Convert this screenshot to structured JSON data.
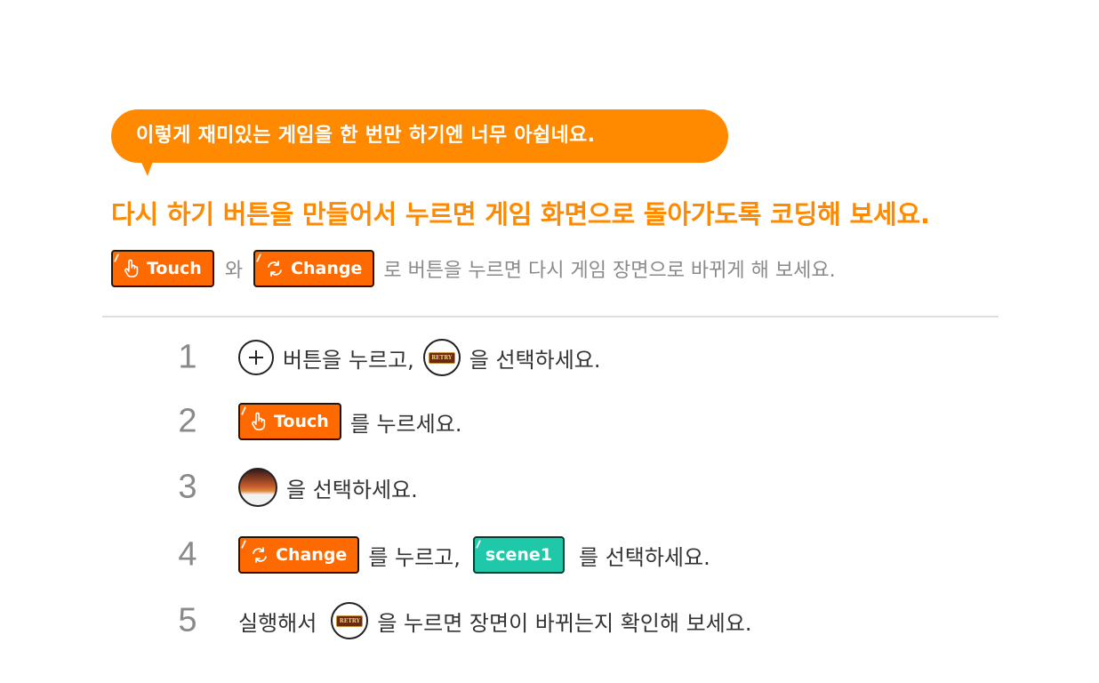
{
  "bubble": {
    "text": "이렇게 재미있는 게임을 한 번만 하기엔 너무 아쉽네요."
  },
  "headline": {
    "text": "다시 하기 버튼을 만들어서 누르면 게임 화면으로 돌아가도록 코딩해 보세요."
  },
  "intro": {
    "touch_label": "Touch",
    "connector": "와",
    "change_label": "Change",
    "tail": "로 버튼을 누르면 다시 게임 장면으로 바뀌게 해 보세요."
  },
  "steps": [
    {
      "num": "1",
      "text_a": "버튼을 누르고,",
      "text_b": "을 선택하세요."
    },
    {
      "num": "2",
      "block_label": "Touch",
      "text_a": "를 누르세요."
    },
    {
      "num": "3",
      "text_a": "을 선택하세요."
    },
    {
      "num": "4",
      "block_label": "Change",
      "text_a": "를 누르고,",
      "scene_label": "scene1",
      "text_b": "를 선택하세요."
    },
    {
      "num": "5",
      "text_a": "실행해서",
      "text_b": "을 누르면 장면이 바뀌는지 확인해 보세요."
    }
  ],
  "icons": {
    "retry_text": "RETRY",
    "colors": {
      "orange": "#ff8a00",
      "block_orange": "#ff6a00",
      "block_green": "#1fc8a8"
    }
  }
}
